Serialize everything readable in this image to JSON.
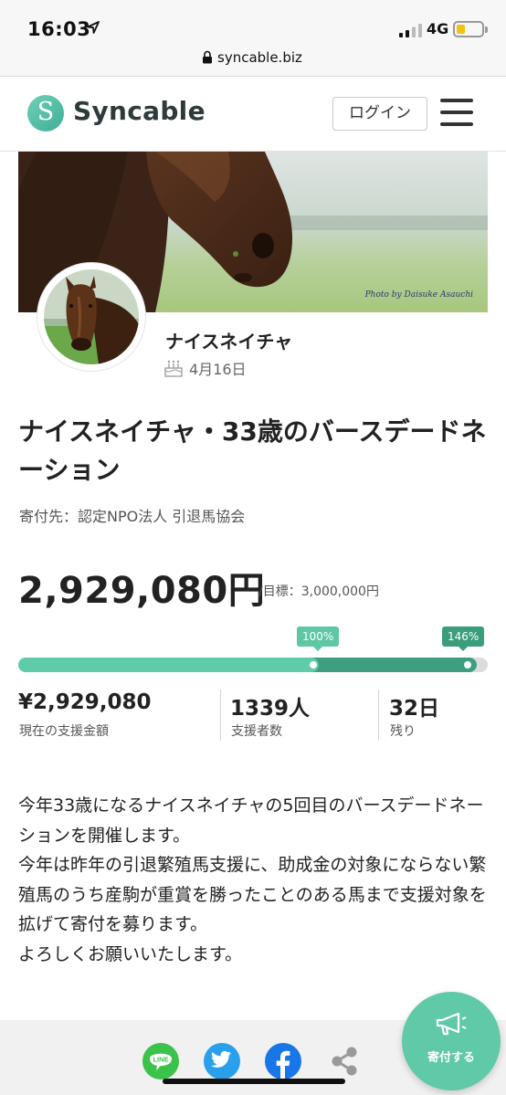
{
  "status_bar": {
    "time": "16:03",
    "network": "4G",
    "battery_color": "#f2c20e"
  },
  "browser": {
    "url": "syncable.biz"
  },
  "header": {
    "brand": "Syncable",
    "logo_letter": "S",
    "login_label": "ログイン",
    "menu_icon": "hamburger-icon"
  },
  "cover": {
    "photo_credit": "Photo by Daisuke Asauchi"
  },
  "profile": {
    "name": "ナイスネイチャ",
    "birthday": "4月16日",
    "birthday_icon": "cake-icon"
  },
  "campaign": {
    "title": "ナイスネイチャ・33歳のバースデードネーション",
    "recipient": "寄付先：認定NPO法人 引退馬協会",
    "amount": "2,929,080円",
    "goal": "/目標：3,000,000円"
  },
  "progress": {
    "tag_first": "100%",
    "tag_second": "146%",
    "fill_first_fraction": 0.976,
    "fill_second_fraction": 1.0
  },
  "stats": [
    {
      "value": "¥2,929,080",
      "label": "現在の支援金額"
    },
    {
      "value": "1339人",
      "label": "支援者数"
    },
    {
      "value": "32日",
      "label": "残り"
    }
  ],
  "description": [
    "今年33歳になるナイスネイチャの5回目のバースデードネーションを開催します。",
    "今年は昨年の引退繁殖馬支援に、助成金の対象にならない繁殖馬のうち産駒が重賞を勝ったことのある馬まで支援対象を拡げて寄付を募ります。",
    "よろしくお願いいたします。"
  ],
  "share": {
    "line_label": "LINE",
    "line_color": "#3ac24a",
    "twitter_color": "#2aa0ec",
    "facebook_color": "#1976e8",
    "share_icon": "share-icon"
  },
  "donate_button": {
    "label": "寄付する",
    "color": "#5fc9a8",
    "icon": "megaphone-icon"
  },
  "colors": {
    "accent": "#5fcba8",
    "accent_dark": "#3d9e80"
  }
}
